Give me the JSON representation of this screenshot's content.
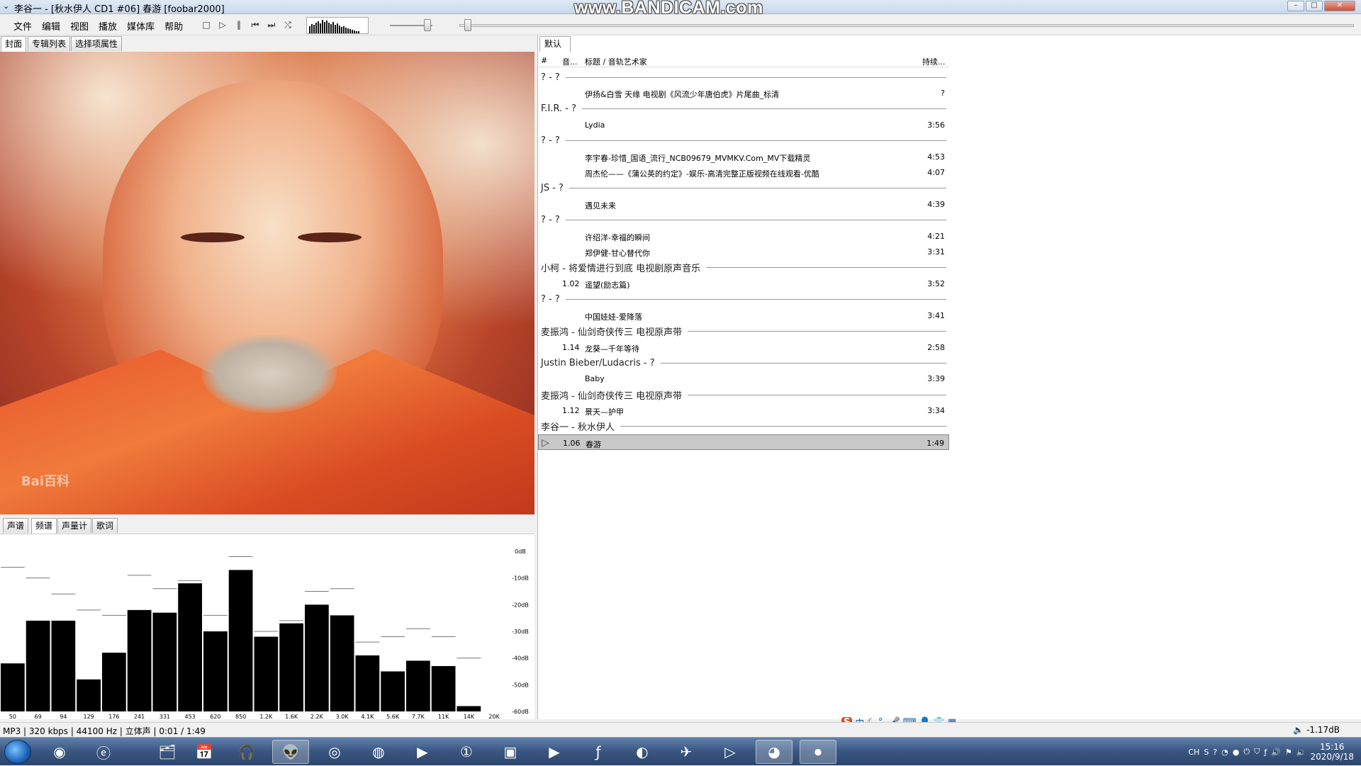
{
  "window": {
    "title": "李谷一 - [秋水伊人 CD1 #06] 春游  [foobar2000]",
    "watermark": "www.BANDICAM.com"
  },
  "menu": [
    "文件",
    "编辑",
    "视图",
    "播放",
    "媒体库",
    "帮助"
  ],
  "left_tabs": [
    "封面",
    "专辑列表",
    "选择项属性"
  ],
  "bottom_tabs": [
    "声谱",
    "频谱",
    "声量计",
    "歌词"
  ],
  "cover": {
    "logo_text": "Bai百科"
  },
  "playlist": {
    "tab": "默认",
    "headers": {
      "num": "#",
      "track": "音...",
      "title": "标题 / 音轨艺术家",
      "duration": "持续..."
    },
    "rows": [
      {
        "type": "group",
        "title": "? - ?"
      },
      {
        "type": "track",
        "num": "",
        "title": "伊扬&白雪 天缘 电视剧《风流少年唐伯虎》片尾曲_标清",
        "duration": "?"
      },
      {
        "type": "group",
        "title": "F.I.R. - ?"
      },
      {
        "type": "track",
        "num": "",
        "title": "Lydia",
        "duration": "3:56"
      },
      {
        "type": "group",
        "title": "? - ?"
      },
      {
        "type": "track",
        "num": "",
        "title": "李宇春-珍惜_国语_流行_NCB09679_MVMKV.Com_MV下载精灵",
        "duration": "4:53"
      },
      {
        "type": "track",
        "num": "",
        "title": "周杰伦——《蒲公英的约定》-娱乐-高清完整正版视频在线观看-优酷",
        "duration": "4:07"
      },
      {
        "type": "group",
        "title": "JS - ?"
      },
      {
        "type": "track",
        "num": "",
        "title": "遇见未来",
        "duration": "4:39"
      },
      {
        "type": "group",
        "title": "? - ?"
      },
      {
        "type": "track",
        "num": "",
        "title": "许绍洋-幸福的瞬间",
        "duration": "4:21"
      },
      {
        "type": "track",
        "num": "",
        "title": "郑伊健-甘心替代你",
        "duration": "3:31"
      },
      {
        "type": "group",
        "title": "小柯 - 将爱情进行到底 电视剧原声音乐"
      },
      {
        "type": "track",
        "num": "1.02",
        "title": "遥望(励志篇)",
        "duration": "3:52"
      },
      {
        "type": "group",
        "title": "? - ?"
      },
      {
        "type": "track",
        "num": "",
        "title": "中国娃娃-爱降落",
        "duration": "3:41"
      },
      {
        "type": "group",
        "title": "麦振鸿 - 仙剑奇侠传三 电视原声带"
      },
      {
        "type": "track",
        "num": "1.14",
        "title": "龙葵—千年等待",
        "duration": "2:58"
      },
      {
        "type": "group",
        "title": "Justin Bieber/Ludacris - ?"
      },
      {
        "type": "track",
        "num": "",
        "title": "Baby",
        "duration": "3:39"
      },
      {
        "type": "group",
        "title": "麦振鸿 - 仙剑奇侠传三 电视原声带"
      },
      {
        "type": "track",
        "num": "1.12",
        "title": "景天—护甲",
        "duration": "3:34"
      },
      {
        "type": "group",
        "title": "李谷一 - 秋水伊人"
      },
      {
        "type": "track",
        "num": "1.06",
        "title": "春游",
        "duration": "1:49",
        "playing": true
      }
    ]
  },
  "spectrum": {
    "db_labels": [
      "0dB",
      "-10dB",
      "-20dB",
      "-30dB",
      "-40dB",
      "-50dB",
      "-60dB"
    ],
    "freq_labels": [
      "50",
      "69",
      "94",
      "129",
      "176",
      "241",
      "331",
      "453",
      "620",
      "850",
      "1.2K",
      "1.6K",
      "2.2K",
      "3.0K",
      "4.1K",
      "5.6K",
      "7.7K",
      "11K",
      "14K",
      "20K"
    ],
    "bar_levels_db": [
      -42,
      -26,
      -26,
      -48,
      -38,
      -22,
      -23,
      -12,
      -30,
      -7,
      -32,
      -27,
      -20,
      -24,
      -39,
      -45,
      -41,
      -43,
      -58,
      -60
    ],
    "peak_levels_db": [
      -6,
      -10,
      -16,
      -22,
      -24,
      -9,
      -14,
      -11,
      -24,
      -2,
      -30,
      -26,
      -15,
      -14,
      -34,
      -32,
      -29,
      -32,
      -40,
      -60
    ]
  },
  "status": {
    "text": "MP3 | 320 kbps | 44100 Hz | 立体声 | 0:01 / 1:49",
    "volume": "-1.17dB"
  },
  "ime": {
    "sogou": "S",
    "mode": "中"
  },
  "tray": {
    "lang": "CH",
    "time": "15:16",
    "date": "2020/9/18"
  }
}
